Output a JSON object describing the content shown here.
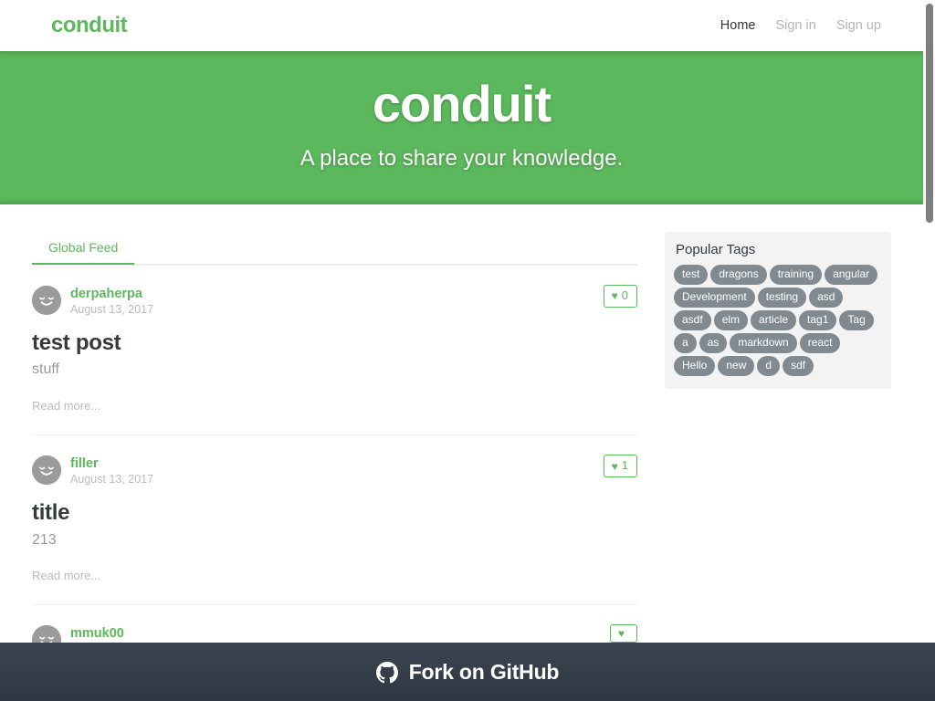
{
  "colors": {
    "brand_green": "#5CB85C",
    "tag_gray": "#818a91",
    "footer_dark": "#2f3742",
    "text_dark": "#373a3c"
  },
  "navbar": {
    "brand": "conduit",
    "links": [
      {
        "label": "Home",
        "active": true
      },
      {
        "label": "Sign in",
        "active": false
      },
      {
        "label": "Sign up",
        "active": false
      }
    ]
  },
  "banner": {
    "title": "conduit",
    "subtitle": "A place to share your knowledge."
  },
  "feed": {
    "tabs": [
      {
        "label": "Global Feed",
        "active": true
      }
    ],
    "articles": [
      {
        "author": "derpaherpa",
        "date": "August 13, 2017",
        "favorites": "0",
        "title": "test post",
        "description": "stuff",
        "read_more": "Read more..."
      },
      {
        "author": "filler",
        "date": "August 13, 2017",
        "favorites": "1",
        "title": "title",
        "description": "213",
        "read_more": "Read more..."
      },
      {
        "author": "mmuk00",
        "date": "",
        "favorites": "",
        "title": "",
        "description": "",
        "read_more": ""
      }
    ]
  },
  "sidebar": {
    "heading": "Popular Tags",
    "tags": [
      "test",
      "dragons",
      "training",
      "angular",
      "Development",
      "testing",
      "asd",
      "asdf",
      "elm",
      "article",
      "tag1",
      "Tag",
      "a",
      "as",
      "markdown",
      "react",
      "Hello",
      "new",
      "d",
      "sdf"
    ]
  },
  "footer": {
    "label": "Fork on GitHub",
    "icon": "github-icon"
  },
  "scrollbar": {
    "thumb_top_px": "4",
    "thumb_height_px": "240"
  }
}
